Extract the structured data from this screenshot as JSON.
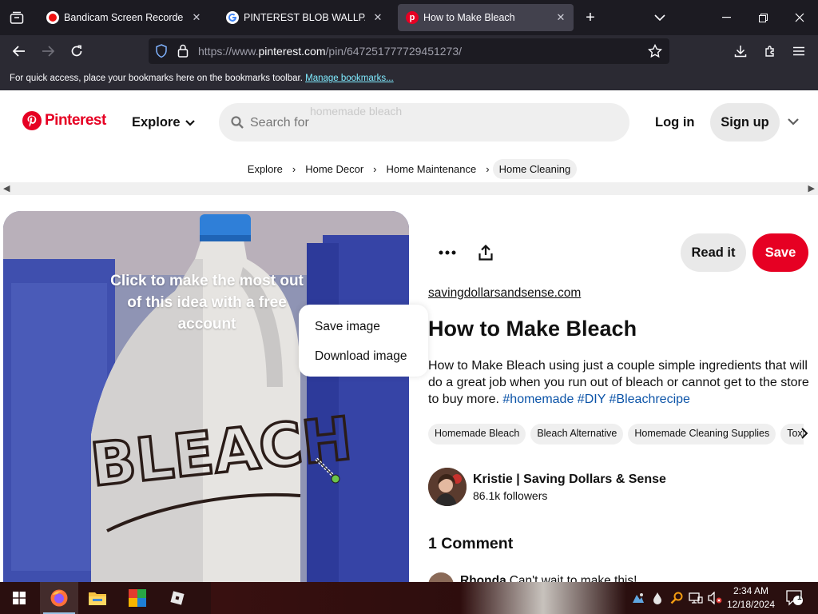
{
  "browser": {
    "tabs": [
      {
        "title": "Bandicam Screen Recorder Dow",
        "active": false
      },
      {
        "title": "PINTEREST BLOB WALLPAPER -",
        "active": false
      },
      {
        "title": "How to Make Bleach",
        "active": true
      }
    ],
    "url_prefix": "https://www.",
    "url_host": "pinterest.com",
    "url_path": "/pin/647251777729451273/",
    "bookmarks_text": "For quick access, place your bookmarks here on the bookmarks toolbar.",
    "bookmarks_link": "Manage bookmarks..."
  },
  "header": {
    "logo_text": "Pinterest",
    "explore_label": "Explore",
    "search_placeholder": "Search for",
    "search_ghost": "homemade bleach",
    "login_label": "Log in",
    "signup_label": "Sign up"
  },
  "breadcrumb": [
    "Explore",
    "Home Decor",
    "Home Maintenance",
    "Home Cleaning"
  ],
  "image": {
    "overlay_text": "Click to make the most out of this idea with a free account",
    "bottle_text": "BLEACH"
  },
  "context_menu": {
    "items": [
      "Save image",
      "Download image"
    ]
  },
  "pin": {
    "read_it_label": "Read it",
    "save_label": "Save",
    "source": "savingdollarsandsense.com",
    "title": "How to Make Bleach",
    "description": "How to Make Bleach using just a couple simple ingredients that will do a great job when you run out of bleach or cannot get to the store to buy more.",
    "hashtags": [
      "#homemade",
      "#DIY",
      "#Bleachrecipe"
    ],
    "tags": [
      "Homemade Bleach",
      "Bleach Alternative",
      "Homemade Cleaning Supplies",
      "Toxic F"
    ],
    "author_name": "Kristie | Saving Dollars & Sense",
    "followers": "86.1k followers",
    "comments_heading": "1 Comment",
    "comment_author": "Rhonda",
    "comment_text": "Can't wait to make this!"
  },
  "taskbar": {
    "time": "2:34 AM",
    "date": "12/18/2024",
    "notification_count": "1"
  },
  "colors": {
    "brand_red": "#e60023",
    "browser_dark": "#1c1b22",
    "hashtag_blue": "#0c54a8"
  }
}
